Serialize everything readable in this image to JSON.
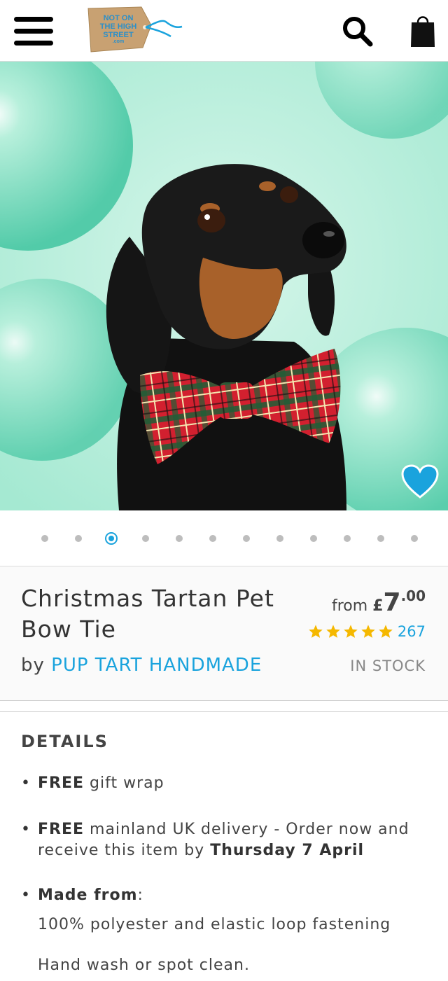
{
  "header": {
    "menu_icon": "hamburger-menu-icon",
    "logo": {
      "line1": "NOT ON",
      "line2": "THE HIGH",
      "line3": "STREET",
      "line4": ".com"
    },
    "search_icon": "search-icon",
    "basket_icon": "shopping-bag-icon"
  },
  "hero": {
    "favourite_icon": "heart-icon",
    "accent_color": "#1aa3dd",
    "background_color": "#bff0de"
  },
  "carousel": {
    "dot_count": 12,
    "active_index": 2
  },
  "product": {
    "title_line1": "Christmas Tartan Pet",
    "title_line2": "Bow Tie",
    "by_prefix": "by",
    "seller": "PUP TART HANDMADE",
    "price_prefix": "from",
    "price_currency": "£",
    "price_int": "7",
    "price_dec": ".00",
    "rating_stars": 5,
    "review_count": "267",
    "stock_status": "IN STOCK"
  },
  "details": {
    "heading": "DETAILS",
    "gift_wrap_strong": "FREE",
    "gift_wrap_text": " gift wrap",
    "delivery_strong": "FREE",
    "delivery_text": " mainland UK delivery - Order now and receive this item by ",
    "delivery_date": "Thursday 7 April",
    "made_from_label": "Made from",
    "made_from_colon": ":",
    "made_from_value": "100% polyester and elastic loop fastening",
    "care_text": "Hand wash or spot clean."
  }
}
